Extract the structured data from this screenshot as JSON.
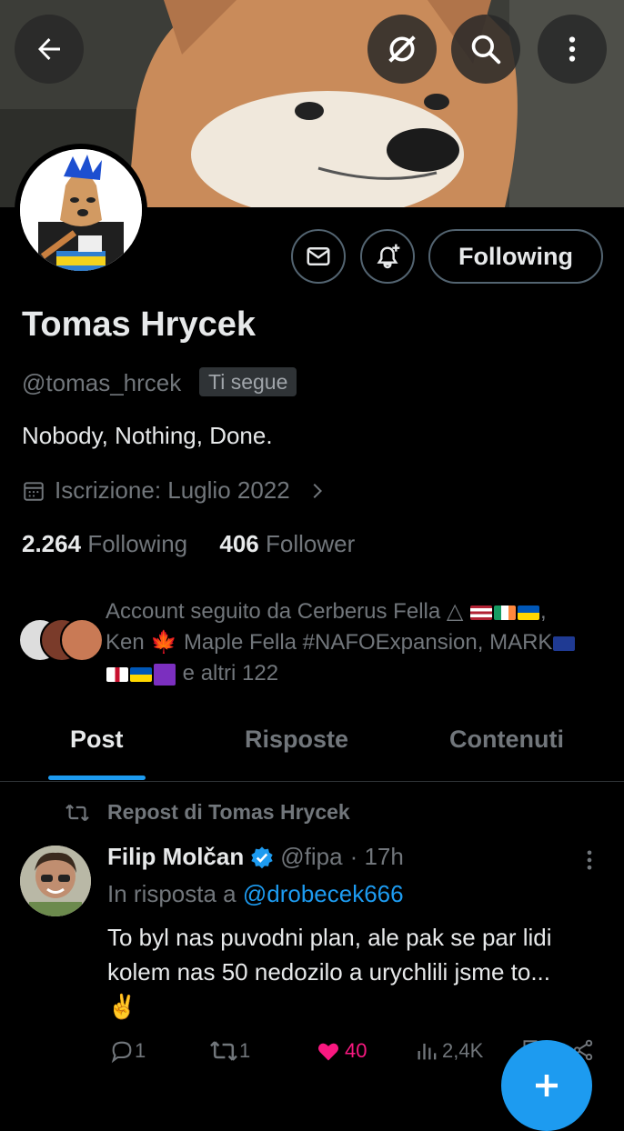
{
  "header": {
    "back_icon": "arrow-left-icon",
    "grok_icon": "grok-slash-icon",
    "search_icon": "search-icon",
    "more_icon": "more-vertical-icon"
  },
  "profile": {
    "name": "Tomas Hrycek",
    "handle": "@tomas_hrcek",
    "follows_you": "Ti segue",
    "bio": "Nobody, Nothing, Done.",
    "joined": "Iscrizione: Luglio 2022",
    "following_count": "2.264",
    "following_label": "Following",
    "followers_count": "406",
    "followers_label": "Follower",
    "follow_button": "Following"
  },
  "followed_by": {
    "line1": "Account seguito da Cerberus Fella △",
    "line2_a": "Ken",
    "line2_b": "Maple Fella #NAFOExpansion, MARK",
    "line3": "e altri 122"
  },
  "tabs": [
    "Post",
    "Risposte",
    "Contenuti"
  ],
  "post": {
    "repost_label": "Repost di Tomas Hrycek",
    "author_name": "Filip Molčan",
    "author_handle": "@fipa",
    "time": "· 17h",
    "reply_prefix": "In risposta a",
    "reply_handle": "@drobecek666",
    "text": "To byl nas puvodni plan, ale pak se par lidi kolem nas 50 nedozilo a urychlili jsme to...",
    "emoji": "✌️",
    "replies": "1",
    "reposts": "1",
    "likes": "40",
    "views": "2,4K"
  },
  "colors": {
    "accent": "#1d9bf0",
    "like": "#f91880",
    "muted": "#71767b",
    "text": "#e7e9ea",
    "border": "#2f3336"
  }
}
